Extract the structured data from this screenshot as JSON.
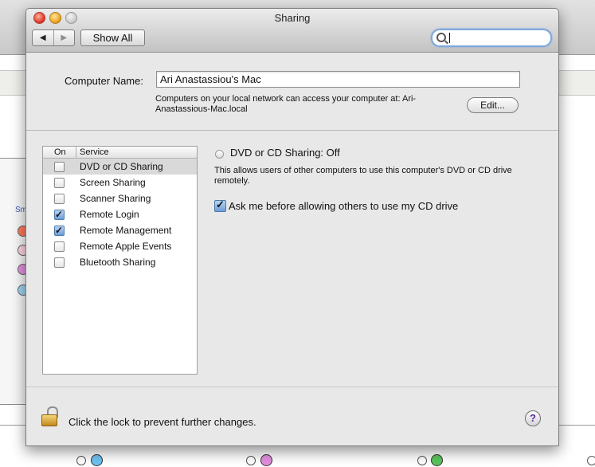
{
  "window": {
    "title": "Sharing",
    "show_all_label": "Show All",
    "back_glyph": "◀",
    "forward_glyph": "▶",
    "search": {
      "value": "",
      "placeholder": ""
    }
  },
  "computer": {
    "label": "Computer Name:",
    "name_value": "Ari Anastassiou's Mac",
    "info": "Computers on your local network can access your computer at: Ari-Anastassious-Mac.local",
    "edit_label": "Edit..."
  },
  "services": {
    "header_on": "On",
    "header_service": "Service",
    "items": [
      {
        "name": "DVD or CD Sharing",
        "on": false,
        "selected": true
      },
      {
        "name": "Screen Sharing",
        "on": false,
        "selected": false
      },
      {
        "name": "Scanner Sharing",
        "on": false,
        "selected": false
      },
      {
        "name": "Remote Login",
        "on": true,
        "selected": false
      },
      {
        "name": "Remote Management",
        "on": true,
        "selected": false
      },
      {
        "name": "Remote Apple Events",
        "on": false,
        "selected": false
      },
      {
        "name": "Bluetooth Sharing",
        "on": false,
        "selected": false
      }
    ]
  },
  "detail": {
    "status": "DVD or CD Sharing: Off",
    "description": "This allows users of other computers to use this computer's DVD or CD drive remotely.",
    "ask_label": "Ask me before allowing others to use my CD drive",
    "ask_checked": true
  },
  "footer": {
    "lock_text": "Click the lock to prevent further changes.",
    "help_label": "?"
  },
  "background": {
    "sidebar_label": "Sm"
  }
}
